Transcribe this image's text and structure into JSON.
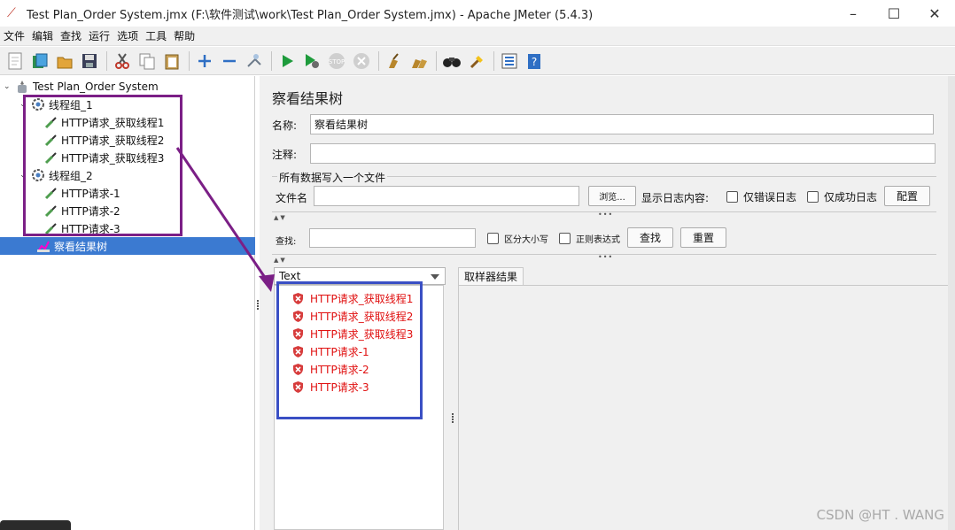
{
  "window": {
    "title": "Test Plan_Order System.jmx (F:\\软件测试\\work\\Test Plan_Order System.jmx) - Apache JMeter (5.4.3)",
    "controls": [
      "–",
      "☐",
      "✕"
    ]
  },
  "menubar": [
    "文件",
    "编辑",
    "查找",
    "运行",
    "选项",
    "工具",
    "帮助"
  ],
  "toolbar": {
    "icons": [
      "new-icon",
      "templates-icon",
      "open-icon",
      "save-icon",
      "cut-icon",
      "copy-icon",
      "paste-icon",
      "expand-icon",
      "collapse-icon",
      "toggle-icon",
      "start-icon",
      "start-no-pause-icon",
      "stop-icon",
      "shutdown-icon",
      "clear-icon",
      "clear-all-icon",
      "search-icon",
      "reset-search-icon",
      "function-helper-icon",
      "help-icon"
    ]
  },
  "tree": {
    "root": "Test Plan_Order System",
    "groups": [
      {
        "name": "线程组_1",
        "samplers": [
          "HTTP请求_获取线程1",
          "HTTP请求_获取线程2",
          "HTTP请求_获取线程3"
        ]
      },
      {
        "name": "线程组_2",
        "samplers": [
          "HTTP请求-1",
          "HTTP请求-2",
          "HTTP请求-3"
        ]
      }
    ],
    "selected": "察看结果树"
  },
  "panel": {
    "title": "察看结果树",
    "name_label": "名称:",
    "name_value": "察看结果树",
    "comment_label": "注释:",
    "comment_value": "",
    "file_section": "所有数据写入一个文件",
    "filename_label": "文件名",
    "filename_value": "",
    "browse_button": "浏览...",
    "log_content_label": "显示日志内容:",
    "errors_only": "仅错误日志",
    "success_only": "仅成功日志",
    "configure_button": "配置",
    "search_label": "查找:",
    "search_value": "",
    "case_sensitive": "区分大小写",
    "regex": "正则表达式",
    "find_button": "查找",
    "reset_button": "重置",
    "renderer_selected": "Text",
    "results": [
      "HTTP请求_获取线程1",
      "HTTP请求_获取线程2",
      "HTTP请求_获取线程3",
      "HTTP请求-1",
      "HTTP请求-2",
      "HTTP请求-3"
    ],
    "detail_tab": "取样器结果"
  },
  "annotations": {
    "purple": "#7b1f86",
    "blue": "#3a4fc4"
  },
  "watermark": "CSDN @HT . WANG"
}
